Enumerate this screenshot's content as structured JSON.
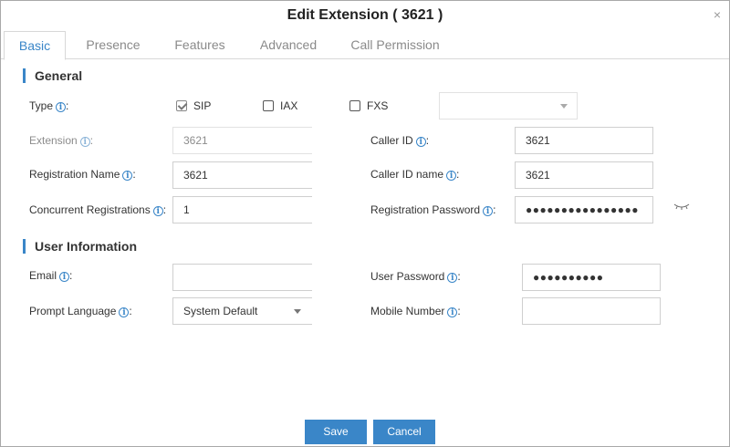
{
  "dialog": {
    "title": "Edit Extension ( 3621 )",
    "close_glyph": "×"
  },
  "tabs": [
    {
      "label": "Basic",
      "active": true
    },
    {
      "label": "Presence"
    },
    {
      "label": "Features"
    },
    {
      "label": "Advanced"
    },
    {
      "label": "Call Permission"
    }
  ],
  "general": {
    "title": "General",
    "type_label": "Type",
    "type_options": [
      {
        "label": "SIP",
        "checked": true
      },
      {
        "label": "IAX",
        "checked": false
      },
      {
        "label": "FXS",
        "checked": false
      }
    ],
    "fxs_port_value": "",
    "extension": {
      "label": "Extension",
      "value": "3621",
      "disabled": true
    },
    "caller_id": {
      "label": "Caller ID",
      "value": "3621"
    },
    "registration_name": {
      "label": "Registration Name",
      "value": "3621"
    },
    "caller_id_name": {
      "label": "Caller ID name",
      "value": "3621"
    },
    "concurrent_registrations": {
      "label": "Concurrent Registrations",
      "value": "1"
    },
    "registration_password": {
      "label": "Registration Password",
      "value": "●●●●●●●●●●●●●●●●"
    }
  },
  "user_information": {
    "title": "User Information",
    "email": {
      "label": "Email",
      "value": ""
    },
    "user_password": {
      "label": "User Password",
      "value": "●●●●●●●●●●"
    },
    "prompt_language": {
      "label": "Prompt Language",
      "value": "System Default"
    },
    "mobile_number": {
      "label": "Mobile Number",
      "value": ""
    }
  },
  "colon": ":",
  "info_glyph": "i",
  "buttons": {
    "save": "Save",
    "cancel": "Cancel"
  },
  "colors": {
    "accent": "#3a86c8"
  },
  "icons": {
    "info": "info-circle-icon",
    "eye": "eye-closed-icon",
    "close": "close-icon"
  }
}
